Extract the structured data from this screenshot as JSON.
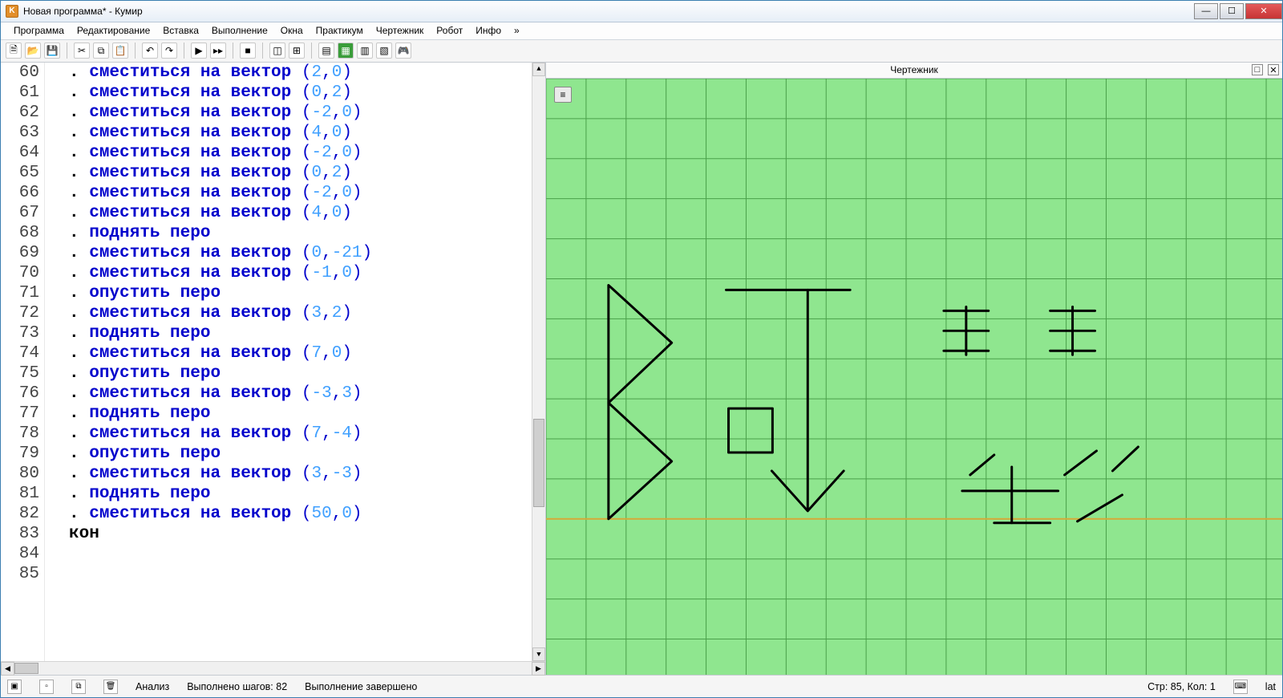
{
  "window": {
    "title": "Новая программа* - Кумир"
  },
  "menu": [
    "Программа",
    "Редактирование",
    "Вставка",
    "Выполнение",
    "Окна",
    "Практикум",
    "Чертежник",
    "Робот",
    "Инфо",
    "»"
  ],
  "panel": {
    "title": "Чертежник"
  },
  "gutter_start": 60,
  "code_lines": [
    {
      "type": "cmd",
      "args": [
        2,
        0
      ]
    },
    {
      "type": "cmd",
      "args": [
        0,
        2
      ]
    },
    {
      "type": "cmd",
      "args": [
        -2,
        0
      ]
    },
    {
      "type": "cmd",
      "args": [
        4,
        0
      ]
    },
    {
      "type": "cmd",
      "args": [
        -2,
        0
      ]
    },
    {
      "type": "cmd",
      "args": [
        0,
        2
      ]
    },
    {
      "type": "cmd",
      "args": [
        -2,
        0
      ]
    },
    {
      "type": "cmd",
      "args": [
        4,
        0
      ]
    },
    {
      "type": "kw",
      "t": "поднять перо"
    },
    {
      "type": "cmd",
      "args": [
        0,
        -21
      ]
    },
    {
      "type": "cmd",
      "args": [
        -1,
        0
      ]
    },
    {
      "type": "kw",
      "t": "опустить перо"
    },
    {
      "type": "cmd",
      "args": [
        3,
        2
      ]
    },
    {
      "type": "kw",
      "t": "поднять перо"
    },
    {
      "type": "cmd",
      "args": [
        7,
        0
      ]
    },
    {
      "type": "kw",
      "t": "опустить перо"
    },
    {
      "type": "cmd",
      "args": [
        -3,
        3
      ]
    },
    {
      "type": "kw",
      "t": "поднять перо"
    },
    {
      "type": "cmd",
      "args": [
        7,
        -4
      ]
    },
    {
      "type": "kw",
      "t": "опустить перо"
    },
    {
      "type": "cmd",
      "args": [
        3,
        -3
      ]
    },
    {
      "type": "kw",
      "t": "поднять перо"
    },
    {
      "type": "cmd",
      "args": [
        50,
        0
      ]
    },
    {
      "type": "end",
      "t": "кон"
    },
    {
      "type": "blank"
    },
    {
      "type": "blank"
    }
  ],
  "cmd_text": "сместиться на вектор",
  "status": {
    "analysis": "Анализ",
    "steps_label": "Выполнено шагов: 82",
    "done": "Выполнение завершено",
    "pos": "Стр: 85, Кол: 1",
    "lang": "lat"
  }
}
